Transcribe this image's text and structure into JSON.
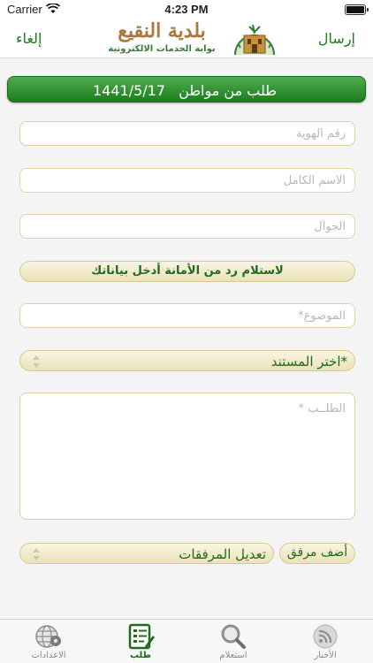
{
  "status_bar": {
    "carrier": "Carrier",
    "time": "4:23 PM"
  },
  "nav": {
    "cancel_label": "إلغاء",
    "send_label": "إرسال"
  },
  "logo": {
    "title": "بلدية النقيع",
    "subtitle": "بوابة الخدمات الالكترونية"
  },
  "header": {
    "title": "طلب من مواطن",
    "date": "1441/5/17"
  },
  "form": {
    "id_number_placeholder": "رقم الهوية",
    "full_name_placeholder": "الاسم الكامل",
    "mobile_placeholder": "الجوال",
    "reply_prompt_label": "لاستلام رد من الأمانة أدخل بياناتك",
    "subject_placeholder": "الموضوع*",
    "document_select_label": "اختر المستند*",
    "request_placeholder": "الطلــب *",
    "add_attachment_label": "أضف مرفق",
    "edit_attachments_label": "تعديل المرفقات"
  },
  "tabs": [
    {
      "label": "الأخبار",
      "icon": "news-rss-icon"
    },
    {
      "label": "استعلام",
      "icon": "search-inquiry-icon"
    },
    {
      "label": "طلب",
      "icon": "request-form-icon"
    },
    {
      "label": "الاعدادات",
      "icon": "settings-globe-icon"
    }
  ],
  "colors": {
    "accent_green": "#1e7b1e",
    "field_border": "#e2d29a",
    "logo_gold": "#a8773c"
  }
}
